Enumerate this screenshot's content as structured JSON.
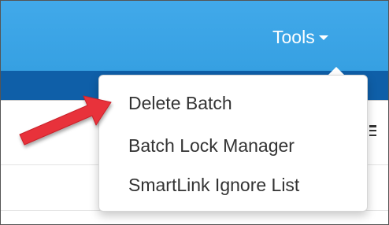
{
  "topbar": {
    "tools_label": "Tools",
    "caret_icon": "caret-down-icon",
    "background_color": "#3aa3e4"
  },
  "subbar": {
    "background_color": "#0f5fa8"
  },
  "toolbar": {
    "menu_icon": "hamburger-icon"
  },
  "dropdown": {
    "items": [
      {
        "label": "Delete Batch"
      },
      {
        "label": "Batch Lock Manager"
      },
      {
        "label": "SmartLink Ignore List"
      }
    ]
  },
  "annotation": {
    "icon": "red-pointer-arrow-icon",
    "color": "#e8323b"
  }
}
